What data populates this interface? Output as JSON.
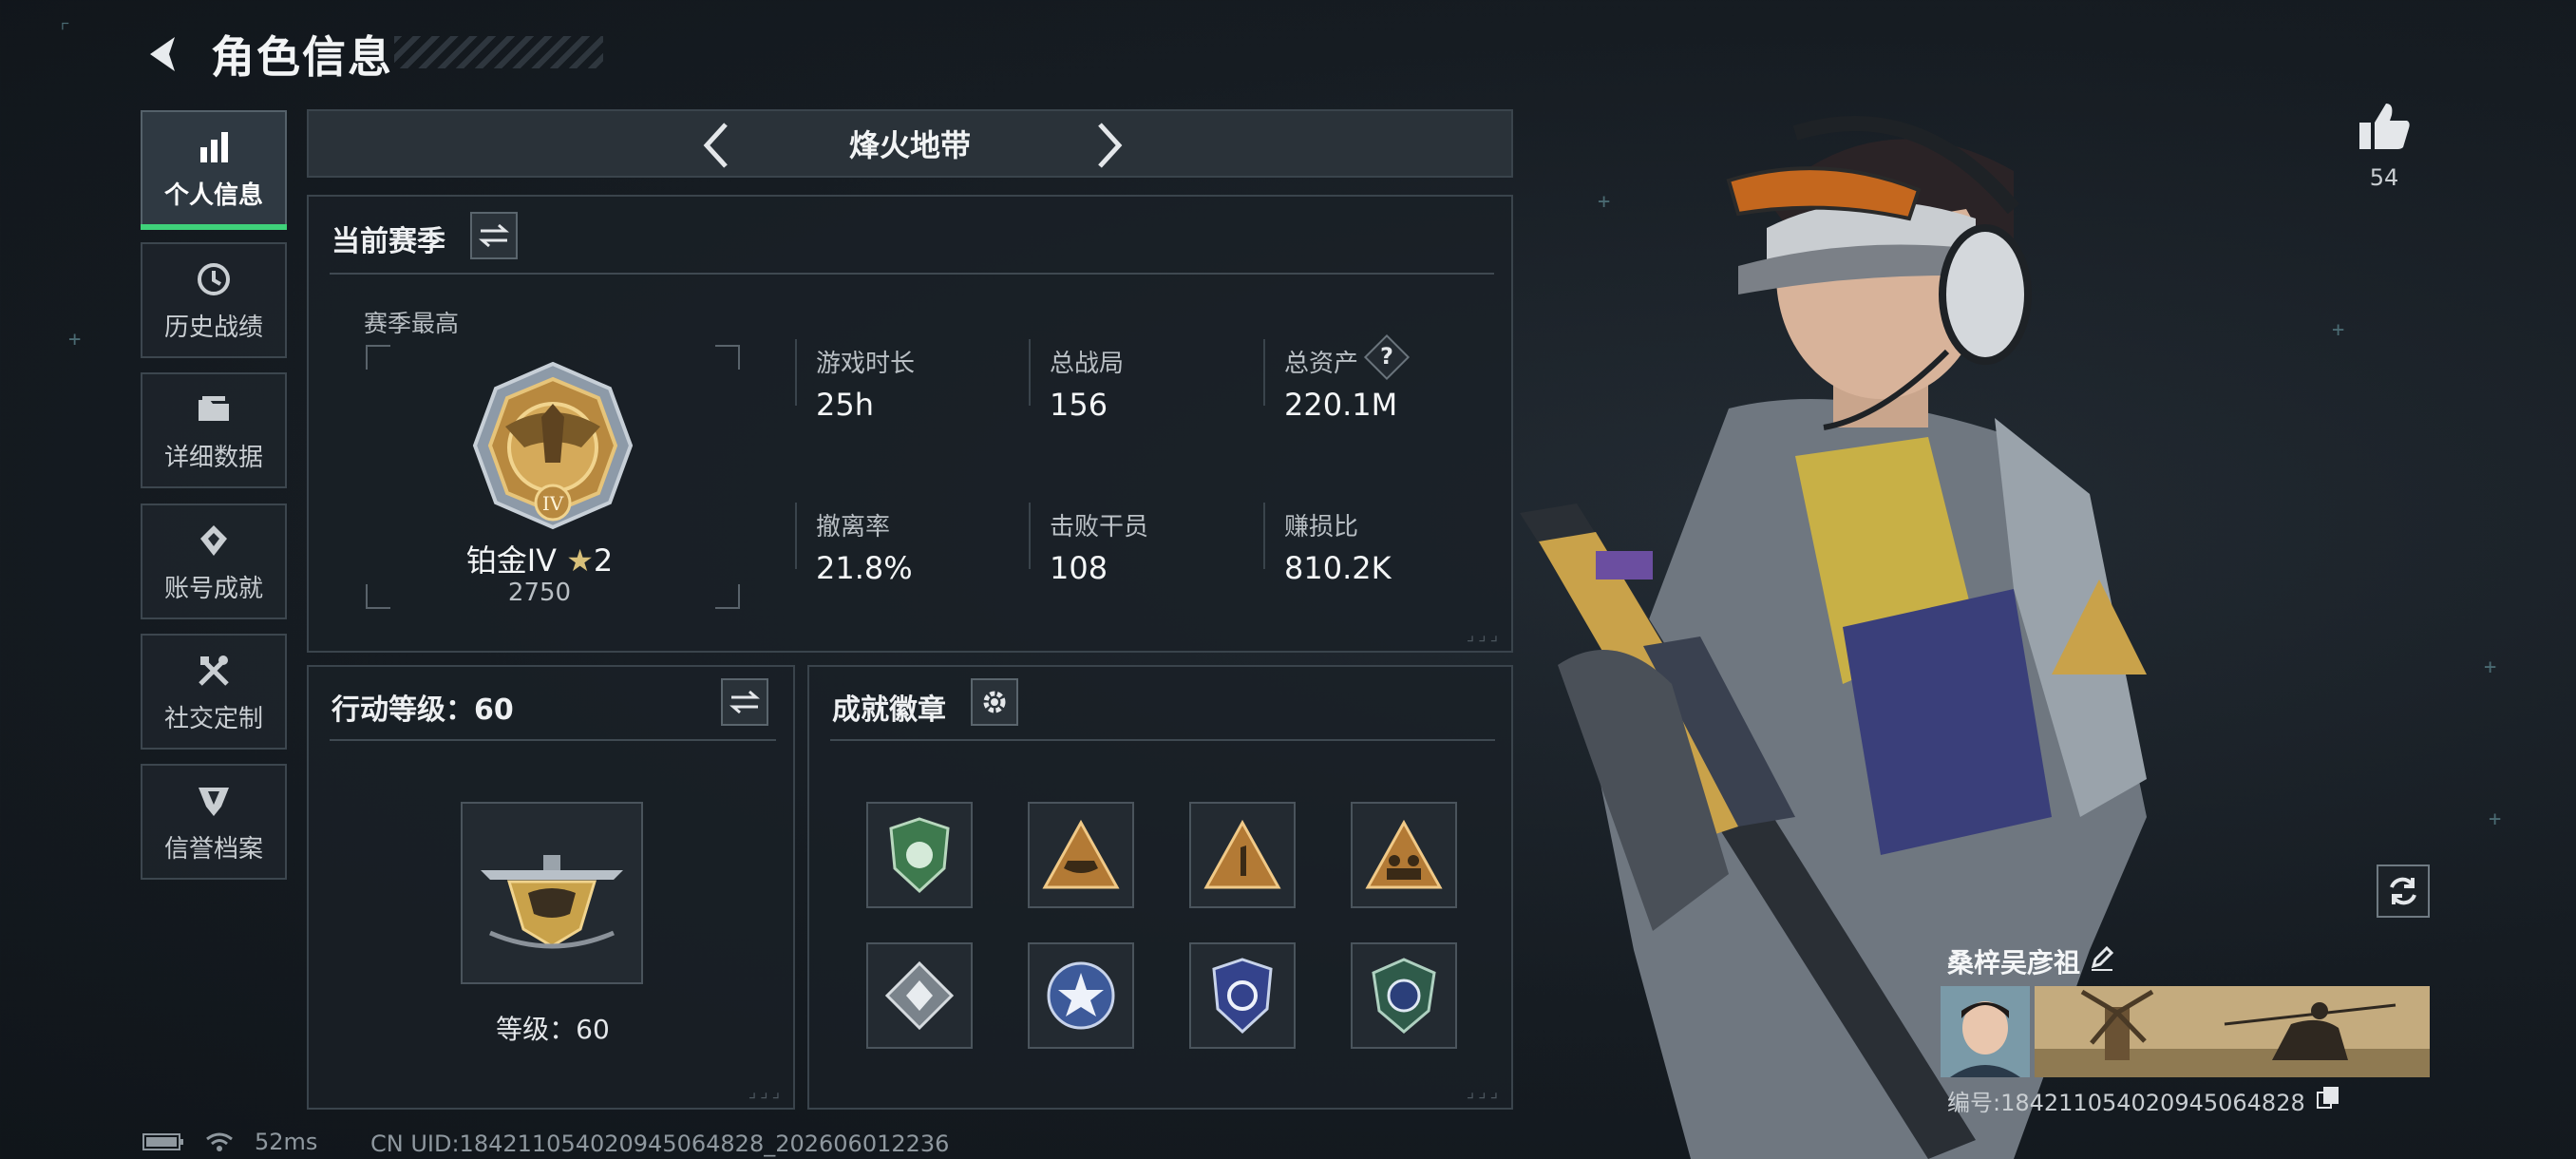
{
  "header": {
    "title": "角色信息"
  },
  "sidebar": {
    "items": [
      {
        "label": "个人信息",
        "icon": "bar-chart-icon",
        "active": true
      },
      {
        "label": "历史战绩",
        "icon": "history-clock-icon",
        "active": false
      },
      {
        "label": "详细数据",
        "icon": "folder-icon",
        "active": false
      },
      {
        "label": "账号成就",
        "icon": "achievement-icon",
        "active": false
      },
      {
        "label": "社交定制",
        "icon": "tools-icon",
        "active": false
      },
      {
        "label": "信誉档案",
        "icon": "shield-emblem-icon",
        "active": false
      }
    ]
  },
  "mode": {
    "title": "烽火地带",
    "prev_icon": "chevron-left-icon",
    "next_icon": "chevron-right-icon"
  },
  "season": {
    "title": "当前赛季",
    "best_label": "赛季最高",
    "rank_name": "铂金IV",
    "rank_stars": "2",
    "rank_score": "2750",
    "stats": [
      {
        "label": "游戏时长",
        "value": "25h"
      },
      {
        "label": "总战局",
        "value": "156"
      },
      {
        "label": "总资产",
        "value": "220.1M",
        "help": "?"
      },
      {
        "label": "撤离率",
        "value": "21.8%"
      },
      {
        "label": "击败干员",
        "value": "108"
      },
      {
        "label": "赚损比",
        "value": "810.2K"
      }
    ]
  },
  "level": {
    "title": "行动等级：60",
    "caption": "等级：60"
  },
  "badges": {
    "title": "成就徽章",
    "items": [
      "green-shield-badge",
      "boat-triangle-badge",
      "number-one-triangle-badge",
      "squad-triangle-badge",
      "diamond-badge",
      "star-round-badge",
      "blue-crest-badge",
      "green-crest-badge"
    ]
  },
  "profile": {
    "likes": "54",
    "name": "桑梓吴彦祖",
    "id_text": "编号:1842110540209450648​28"
  },
  "status": {
    "ping": "52ms",
    "uid": "CN UID:184211054020945064828_202606012236"
  },
  "colors": {
    "accent_green": "#3fd27a",
    "gold": "#c9a24a",
    "panel_border": "#3a444c"
  }
}
